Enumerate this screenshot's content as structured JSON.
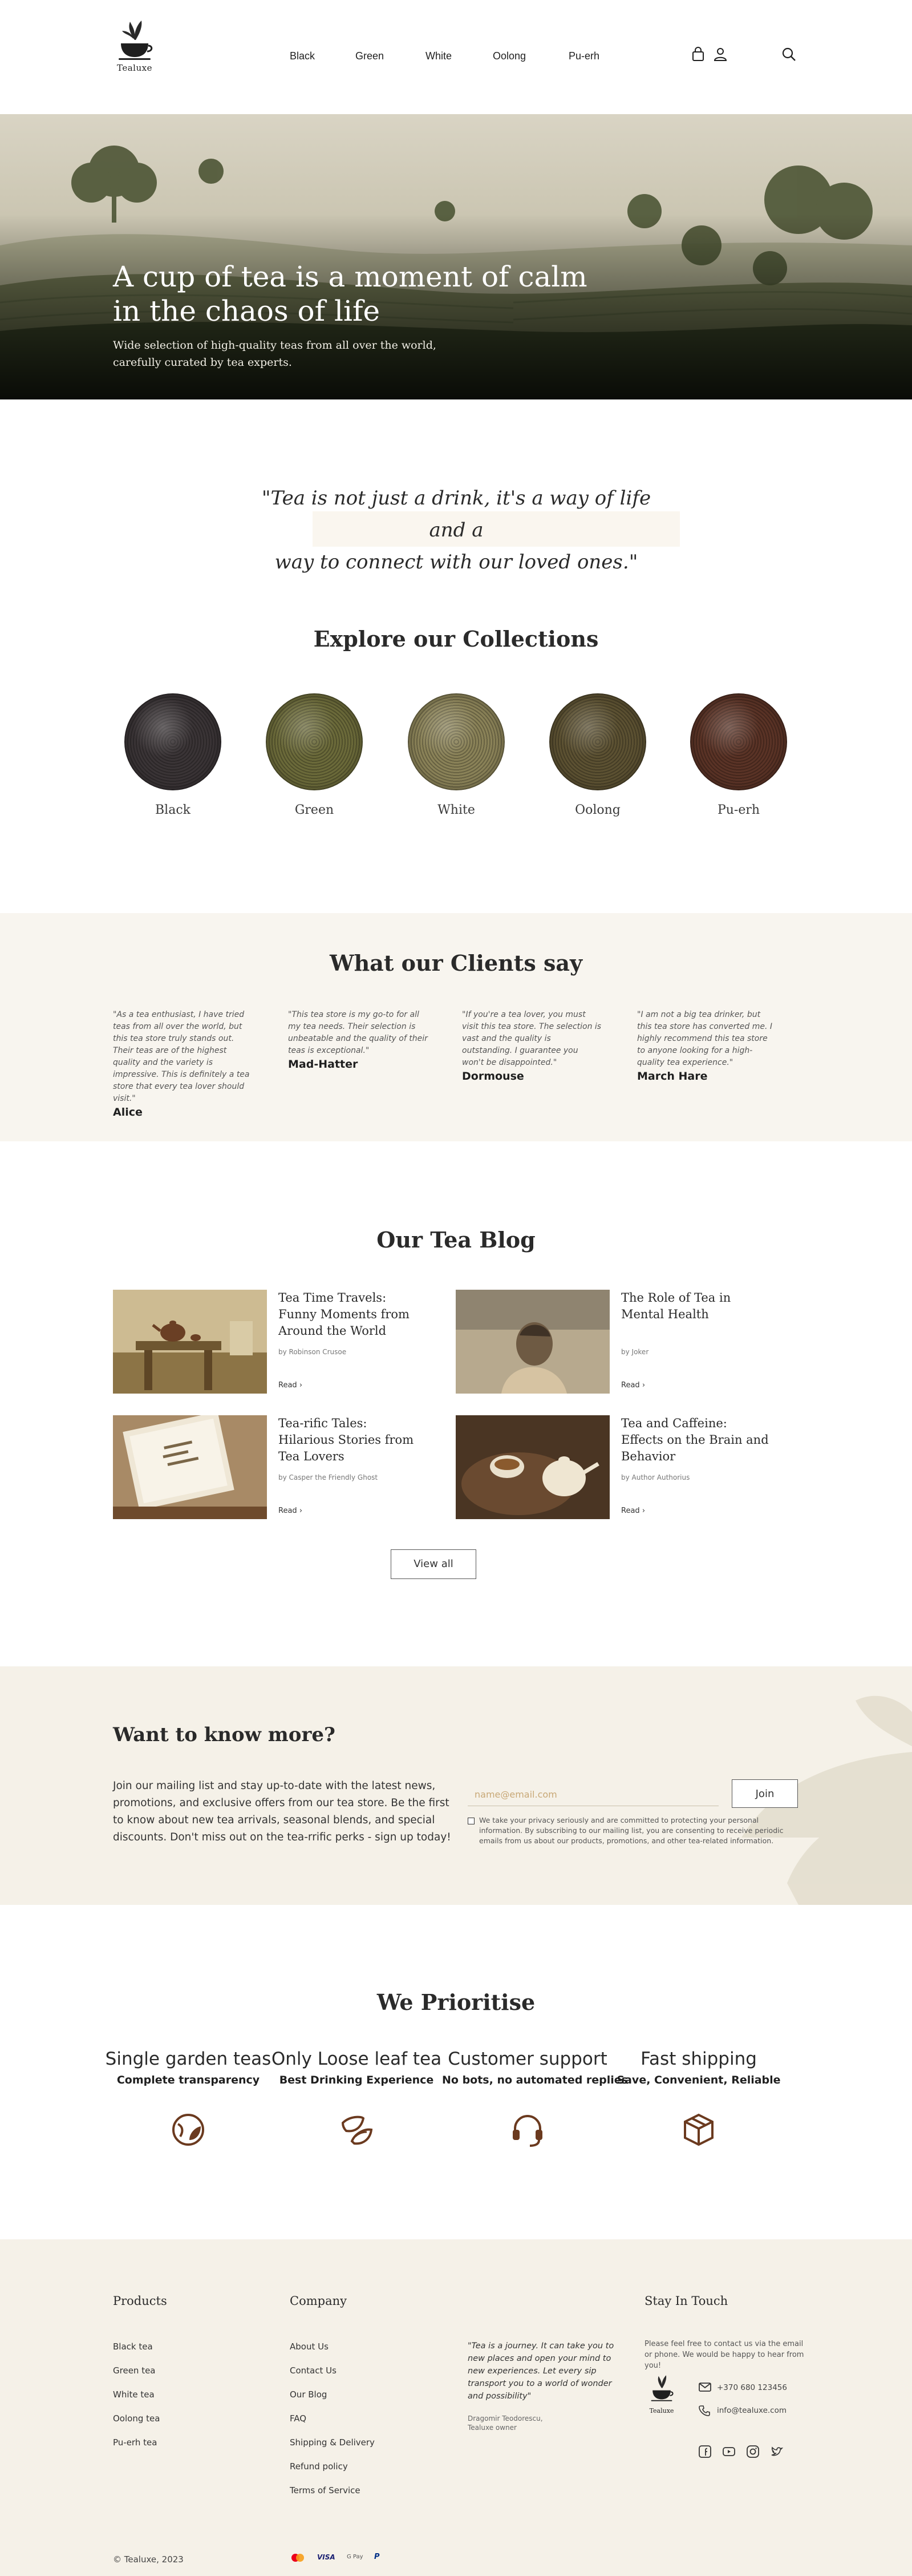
{
  "brand": {
    "logo_text": "Tealuxe"
  },
  "nav": [
    "Black",
    "Green",
    "White",
    "Oolong",
    "Pu-erh"
  ],
  "hero": {
    "title_line1": "A cup of tea is a moment of calm",
    "title_line2": "in the chaos of life",
    "subtitle_line1": "Wide selection of high-quality teas from all over the world,",
    "subtitle_line2": "carefully curated by tea experts."
  },
  "quote": {
    "line1": "\"Tea is not just a drink, it's a way of life and a",
    "line2": "way to connect with our loved ones.\""
  },
  "collections": {
    "title": "Explore our Collections",
    "items": [
      {
        "label": "Black",
        "color": "#3a3436"
      },
      {
        "label": "Green",
        "color": "#6b6a3a"
      },
      {
        "label": "White",
        "color": "#8a8258"
      },
      {
        "label": "Oolong",
        "color": "#5c5132"
      },
      {
        "label": "Pu-erh",
        "color": "#5a3326"
      }
    ]
  },
  "testimonials": {
    "title": "What our Clients say",
    "items": [
      {
        "text": "\"As a tea enthusiast, I have tried teas from all over the world, but this tea store truly stands out. Their teas are of the highest quality and the variety is impressive. This is definitely a tea store that every tea lover should visit.\"",
        "name": "Alice"
      },
      {
        "text": "\"This tea store is my go-to for all my tea needs. Their selection is unbeatable and the quality of their teas is exceptional.\"",
        "name": "Mad-Hatter"
      },
      {
        "text": "\"If you're a tea lover, you must visit this tea store. The selection is vast and the quality is outstanding. I guarantee you won't be disappointed.\"",
        "name": "Dormouse"
      },
      {
        "text": "\"I am not a big tea drinker, but this tea store has converted me. I highly recommend this tea store to anyone looking for a high-quality tea experience.\"",
        "name": "March Hare"
      }
    ]
  },
  "blog": {
    "title": "Our Tea Blog",
    "read_label": "Read",
    "view_all": "View all",
    "posts": [
      {
        "title": "Tea Time Travels: Funny Moments from Around the World",
        "author": "by Robinson Crusoe"
      },
      {
        "title": "The Role of Tea in Mental Health",
        "author": "by Joker"
      },
      {
        "title": "Tea-rific Tales: Hilarious Stories from Tea Lovers",
        "author": "by Casper the Friendly Ghost"
      },
      {
        "title": "Tea and Caffeine: Effects on the Brain and Behavior",
        "author": "by Author Authorius"
      }
    ]
  },
  "newsletter": {
    "title": "Want to know more?",
    "text": "Join our mailing list and stay up-to-date with the latest news, promotions, and exclusive offers from our tea store. Be the first to know about new tea arrivals, seasonal blends, and special discounts. Don't miss out on the tea-rrific perks - sign up today!",
    "placeholder": "name@email.com",
    "button": "Join",
    "consent": "We take your privacy seriously and are committed to protecting your personal information. By subscribing to our mailing list, you are consenting to receive periodic emails from us about our products, promotions, and other tea-related information."
  },
  "prioritise": {
    "title": "We Prioritise",
    "items": [
      {
        "title": "Single garden teas",
        "subtitle": "Complete transparency",
        "icon": "globe-leaf-icon"
      },
      {
        "title": "Only Loose leaf tea",
        "subtitle": "Best Drinking Experience",
        "icon": "leaves-icon"
      },
      {
        "title": "Customer support",
        "subtitle": "No bots, no automated replies",
        "icon": "headset-icon"
      },
      {
        "title": "Fast shipping",
        "subtitle": "Save, Convenient, Reliable",
        "icon": "box-icon"
      }
    ]
  },
  "footer": {
    "products_heading": "Products",
    "products": [
      "Black tea",
      "Green tea",
      "White tea",
      "Oolong tea",
      "Pu-erh tea"
    ],
    "company_heading": "Company",
    "company": [
      "About Us",
      "Contact Us",
      "Our Blog",
      "FAQ",
      "Shipping & Delivery",
      "Refund policy",
      "Terms of Service"
    ],
    "quote": "\"Tea is a journey. It can take you to new places and open your mind to new experiences. Let every sip transport you to a world of wonder and possibility\"",
    "quote_author_line1": "Dragomir Teodorescu,",
    "quote_author_line2": "Tealuxe owner",
    "contact_heading": "Stay In Touch",
    "contact_text": "Please feel free to contact us via the email or phone. We would be happy to hear from you!",
    "phone": "+370 680 123456",
    "email": "info@tealuxe.com",
    "copyright": "© Tealuxe, 2023",
    "payments": [
      "Mastercard",
      "VISA",
      "G Pay",
      "PayPal"
    ]
  },
  "colors": {
    "accent": "#6b3a1f",
    "cream": "#f5f1e8",
    "testimonial_bg": "#f8f5ef"
  }
}
